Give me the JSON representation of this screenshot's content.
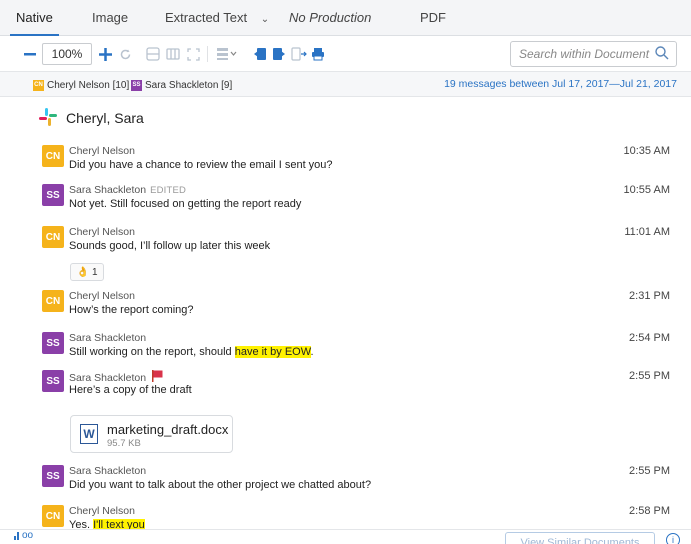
{
  "tabs": [
    {
      "label": "Native"
    },
    {
      "label": "Image"
    },
    {
      "label": "Extracted Text"
    },
    {
      "label": "No Production"
    },
    {
      "label": "PDF"
    }
  ],
  "toolbar": {
    "zoom_value": "100%",
    "search_placeholder": "Search within Document"
  },
  "participants": [
    {
      "initials": "CN",
      "name": "Cheryl Nelson [10]",
      "color": "#f5b31b"
    },
    {
      "initials": "SS",
      "name": "Sara Shackleton [9]",
      "color": "#8a3fa8"
    }
  ],
  "summary": "19 messages between Jul 17, 2017—Jul 21, 2017",
  "channel": {
    "name": "Cheryl, Sara"
  },
  "messages": [
    {
      "initials": "CN",
      "author": "Cheryl Nelson",
      "text": "Did you have a chance to review the email I sent you?",
      "time": "10:35 AM"
    },
    {
      "initials": "SS",
      "author": "Sara Shackleton",
      "edited": "EDITED",
      "text": "Not yet. Still focused on getting the report ready",
      "time": "10:55 AM"
    },
    {
      "initials": "CN",
      "author": "Cheryl Nelson",
      "text": "Sounds good, I’ll follow up later this week",
      "time": "11:01 AM"
    },
    {
      "initials": "CN",
      "author": "Cheryl Nelson",
      "text": "How’s the report coming?",
      "time": "2:31 PM"
    },
    {
      "initials": "SS",
      "author": "Sara Shackleton",
      "text_pre": "Still working on the report, should ",
      "text_hl": "have it by EOW",
      "text_post": ".",
      "time": "2:54 PM"
    },
    {
      "initials": "SS",
      "author": "Sara Shackleton",
      "text": "Here’s a copy of the draft",
      "time": "2:55 PM"
    },
    {
      "initials": "SS",
      "author": "Sara Shackleton",
      "text": "Did you want to talk about the other project we chatted about?",
      "time": "2:55 PM"
    },
    {
      "initials": "CN",
      "author": "Cheryl Nelson",
      "text_pre": "Yes. ",
      "text_hl": "I'll text you",
      "time": "2:58 PM"
    }
  ],
  "reaction": {
    "emoji": "👌",
    "count": "1"
  },
  "attachment": {
    "icon": "W",
    "name": "marketing_draft.docx",
    "size": "95.7 KB"
  },
  "bottom": {
    "similar_button": "View Similar Documents",
    "left_label": "oo",
    "info": "i"
  },
  "colors": {
    "accent": "#2a73c4",
    "cn_avatar": "#f5b31b",
    "ss_avatar": "#8a3fa8",
    "highlight": "#fff200"
  }
}
